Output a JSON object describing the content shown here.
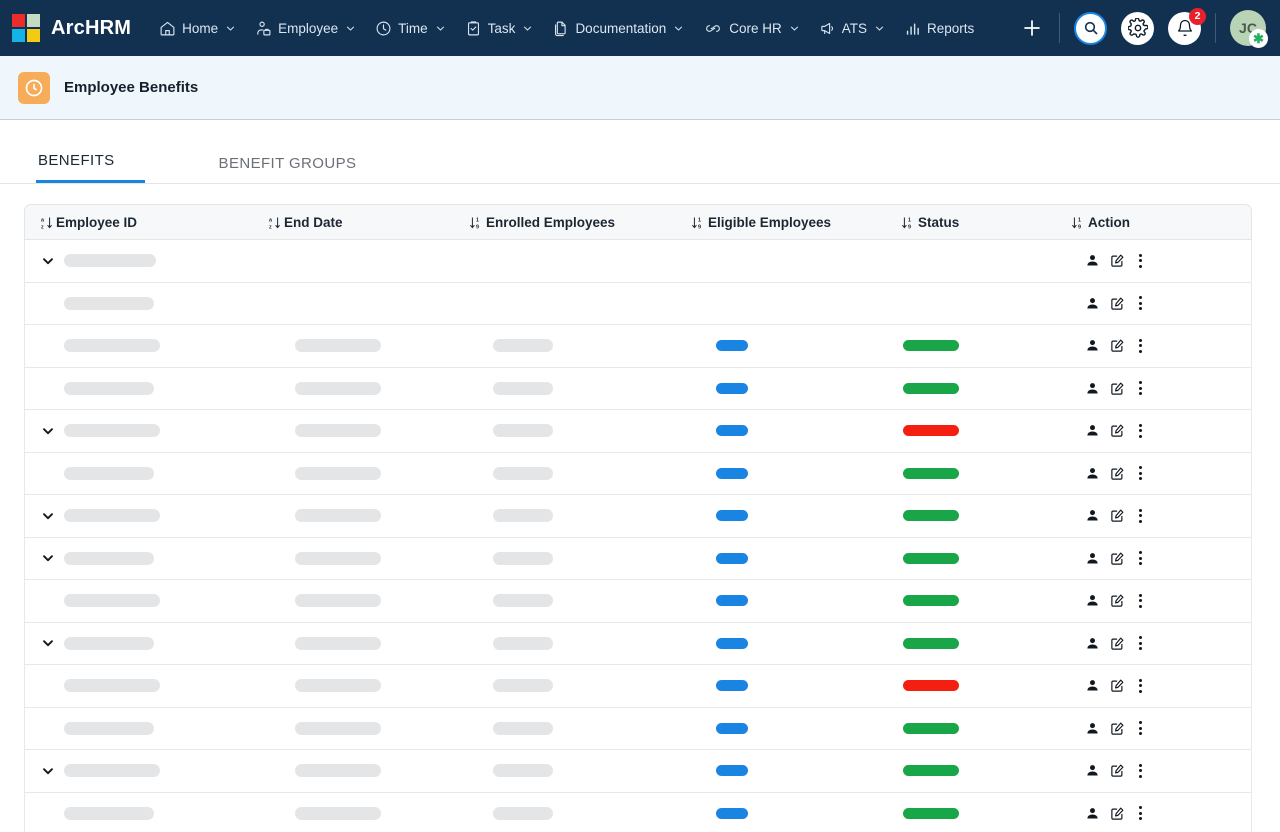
{
  "brand": {
    "name": "ArcHRM",
    "logo_colors": [
      "#ec2b2b",
      "#c5dcc4",
      "#15b4e8",
      "#f2cb12"
    ]
  },
  "nav": {
    "items": [
      {
        "label": "Home",
        "icon": "home-icon",
        "caret": true
      },
      {
        "label": "Employee",
        "icon": "employee-icon",
        "caret": true
      },
      {
        "label": "Time",
        "icon": "clock-icon",
        "caret": true
      },
      {
        "label": "Task",
        "icon": "clipboard-check-icon",
        "caret": true
      },
      {
        "label": "Documentation",
        "icon": "documents-icon",
        "caret": true
      },
      {
        "label": "Core HR",
        "icon": "infinity-icon",
        "caret": true
      },
      {
        "label": "ATS",
        "icon": "megaphone-icon",
        "caret": true
      },
      {
        "label": "Reports",
        "icon": "bar-chart-icon",
        "caret": false
      }
    ],
    "right": {
      "add_icon": "plus-icon",
      "search_icon": "search-icon",
      "settings_icon": "gear-icon",
      "notifications_icon": "bell-icon",
      "notifications_count": "2",
      "avatar_initials": "JC",
      "avatar_badge_icon": "verified-icon"
    }
  },
  "page": {
    "icon": "clock-icon",
    "title": "Employee Benefits",
    "icon_color": "#f7ac59"
  },
  "tabs": [
    {
      "label": "BENEFITS",
      "active": true
    },
    {
      "label": "BENEFIT GROUPS",
      "active": false
    }
  ],
  "table": {
    "columns": [
      {
        "label": "Employee ID",
        "sort": "alpha"
      },
      {
        "label": "End Date",
        "sort": "alpha"
      },
      {
        "label": "Enrolled Employees",
        "sort": "numeric"
      },
      {
        "label": "Eligible Employees",
        "sort": "numeric"
      },
      {
        "label": "Status",
        "sort": "numeric"
      },
      {
        "label": "Action",
        "sort": "numeric"
      }
    ],
    "row_actions": [
      "person-icon",
      "edit-icon",
      "more-vertical-icon"
    ],
    "rows": [
      {
        "expander": true,
        "c1": 92,
        "c2": 0,
        "c3": 0,
        "eligible": null,
        "status": null
      },
      {
        "expander": false,
        "c1": 90,
        "c2": 0,
        "c3": 0,
        "eligible": null,
        "status": null
      },
      {
        "expander": false,
        "c1": 96,
        "c2": 86,
        "c3": 60,
        "eligible": "blue",
        "status": "green"
      },
      {
        "expander": false,
        "c1": 90,
        "c2": 86,
        "c3": 60,
        "eligible": "blue",
        "status": "green"
      },
      {
        "expander": true,
        "c1": 96,
        "c2": 86,
        "c3": 60,
        "eligible": "blue",
        "status": "red"
      },
      {
        "expander": false,
        "c1": 90,
        "c2": 86,
        "c3": 60,
        "eligible": "blue",
        "status": "green"
      },
      {
        "expander": true,
        "c1": 96,
        "c2": 86,
        "c3": 60,
        "eligible": "blue",
        "status": "green"
      },
      {
        "expander": true,
        "c1": 90,
        "c2": 86,
        "c3": 60,
        "eligible": "blue",
        "status": "green"
      },
      {
        "expander": false,
        "c1": 96,
        "c2": 86,
        "c3": 60,
        "eligible": "blue",
        "status": "green"
      },
      {
        "expander": true,
        "c1": 90,
        "c2": 86,
        "c3": 60,
        "eligible": "blue",
        "status": "green"
      },
      {
        "expander": false,
        "c1": 96,
        "c2": 86,
        "c3": 60,
        "eligible": "blue",
        "status": "red"
      },
      {
        "expander": false,
        "c1": 90,
        "c2": 86,
        "c3": 60,
        "eligible": "blue",
        "status": "green"
      },
      {
        "expander": true,
        "c1": 96,
        "c2": 86,
        "c3": 60,
        "eligible": "blue",
        "status": "green"
      },
      {
        "expander": false,
        "c1": 90,
        "c2": 86,
        "c3": 60,
        "eligible": "blue",
        "status": "green"
      }
    ]
  }
}
